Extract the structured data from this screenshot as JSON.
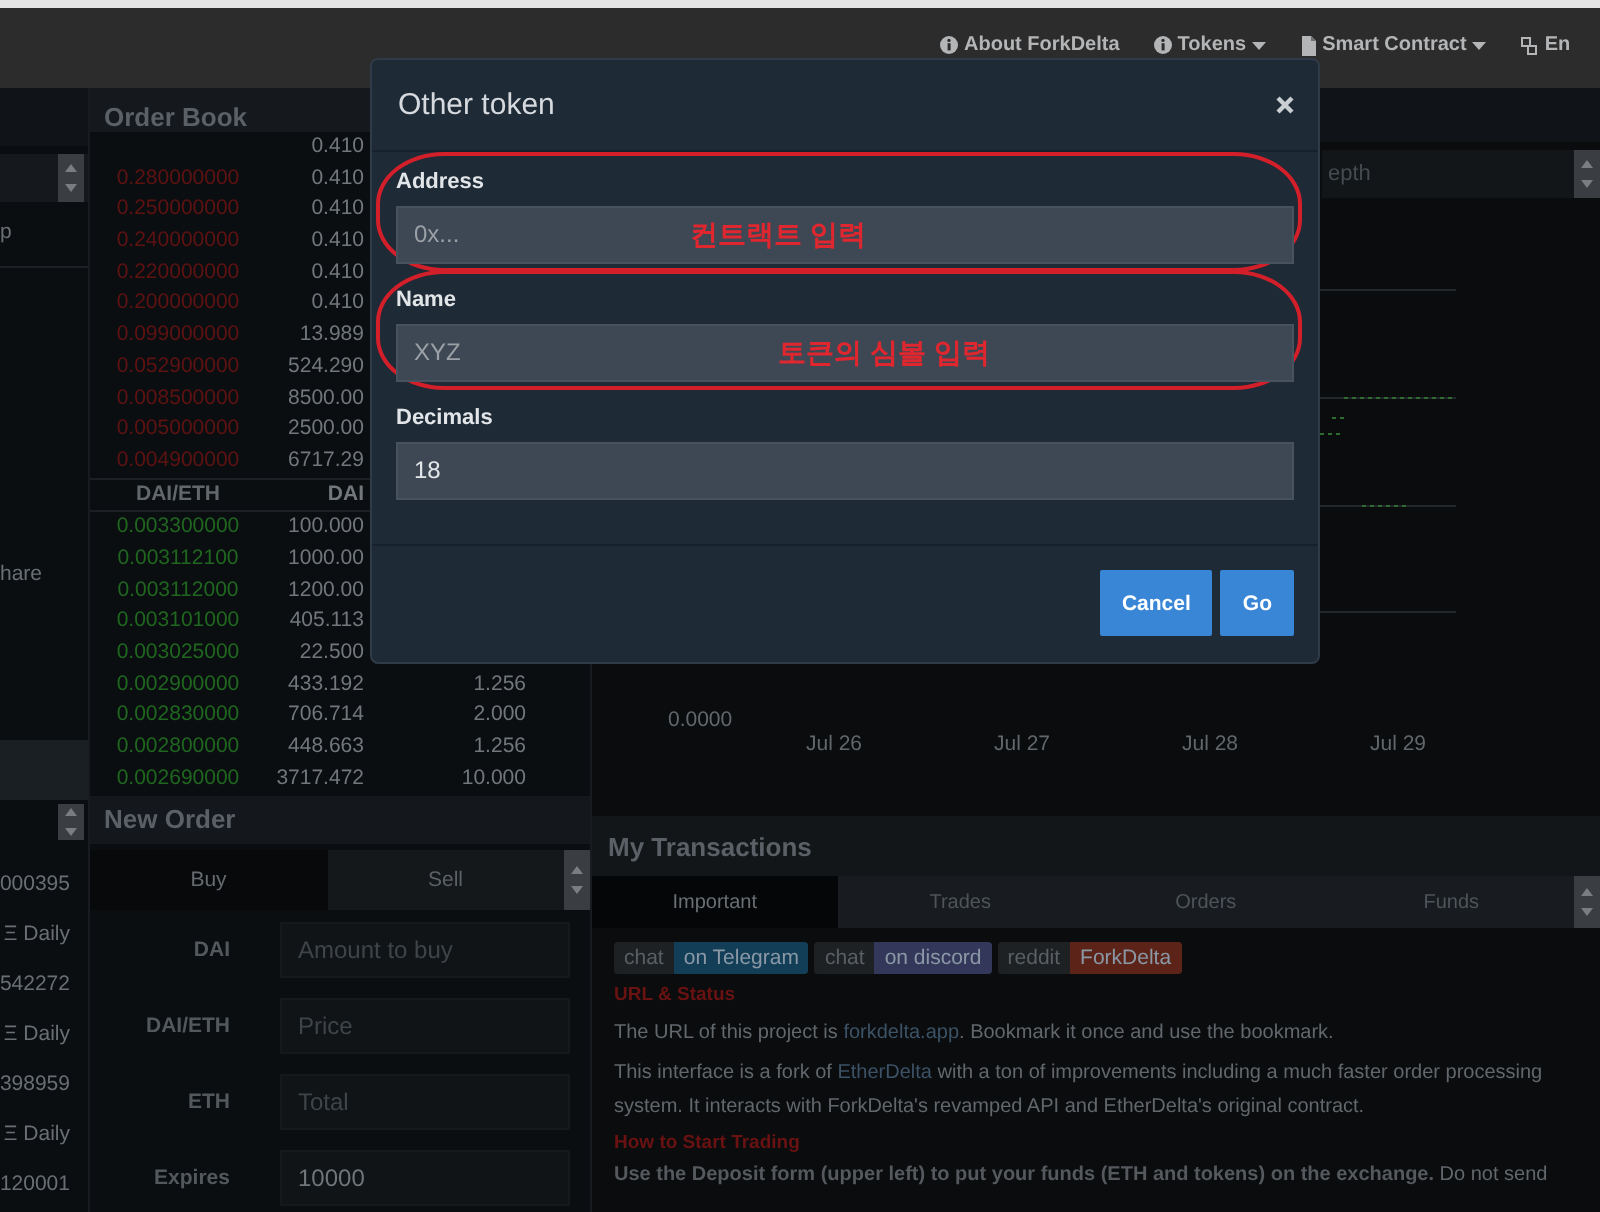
{
  "nav": {
    "items": [
      {
        "label": "About ForkDelta",
        "dropdown": false
      },
      {
        "label": "Tokens",
        "dropdown": true
      },
      {
        "label": "Smart Contract",
        "dropdown": true
      },
      {
        "label": "En",
        "dropdown": false
      }
    ]
  },
  "left_panel": {
    "top_texts": [
      "p",
      "hare"
    ],
    "rows": [
      {
        "value": "000395",
        "period": "Ξ Daily"
      },
      {
        "value": "542272",
        "period": "Ξ Daily"
      },
      {
        "value": "398959",
        "period": "Ξ Daily"
      },
      {
        "value": "120001"
      }
    ]
  },
  "order_book": {
    "title": "Order Book",
    "sell_rows": [
      {
        "amount": "0.410"
      },
      {
        "price": "0.280000000",
        "amount": "0.410"
      },
      {
        "price": "0.250000000",
        "amount": "0.410"
      },
      {
        "price": "0.240000000",
        "amount": "0.410"
      },
      {
        "price": "0.220000000",
        "amount": "0.410"
      },
      {
        "price": "0.200000000",
        "amount": "0.410"
      },
      {
        "price": "0.099000000",
        "amount": "13.989"
      },
      {
        "price": "0.052900000",
        "amount": "524.290"
      },
      {
        "price": "0.008500000",
        "amount": "8500.00"
      },
      {
        "price": "0.005000000",
        "amount": "2500.00"
      },
      {
        "price": "0.004900000",
        "amount": "6717.29"
      }
    ],
    "columns": [
      "DAI/ETH",
      "DAI"
    ],
    "buy_rows": [
      {
        "price": "0.003300000",
        "amount": "100.000"
      },
      {
        "price": "0.003112100",
        "amount": "1000.00"
      },
      {
        "price": "0.003112000",
        "amount": "1200.00"
      },
      {
        "price": "0.003101000",
        "amount": "405.113"
      },
      {
        "price": "0.003025000",
        "amount": "22.500"
      },
      {
        "price": "0.002900000",
        "amount": "433.192",
        "total": "1.256"
      },
      {
        "price": "0.002830000",
        "amount": "706.714",
        "total": "2.000"
      },
      {
        "price": "0.002800000",
        "amount": "448.663",
        "total": "1.256"
      },
      {
        "price": "0.002690000",
        "amount": "3717.472",
        "total": "10.000"
      }
    ]
  },
  "new_order": {
    "title": "New Order",
    "tabs": [
      {
        "label": "Buy",
        "selected": true
      },
      {
        "label": "Sell",
        "selected": false
      }
    ],
    "fields": [
      {
        "label": "DAI",
        "placeholder": "Amount to buy"
      },
      {
        "label": "DAI/ETH",
        "placeholder": "Price"
      },
      {
        "label": "ETH",
        "placeholder": "Total"
      },
      {
        "label": "Expires",
        "value": "10000"
      }
    ]
  },
  "chart": {
    "select_value": "epth",
    "y_label": "0.0000",
    "x_labels": [
      "Jul 26",
      "Jul 27",
      "Jul 28",
      "Jul 29"
    ]
  },
  "transactions": {
    "title": "My Transactions",
    "tabs": [
      {
        "label": "Important",
        "selected": true
      },
      {
        "label": "Trades",
        "selected": false
      },
      {
        "label": "Orders",
        "selected": false
      },
      {
        "label": "Funds",
        "selected": false
      }
    ],
    "badges": [
      {
        "left": "chat",
        "right": "on Telegram",
        "color": "#123f57"
      },
      {
        "left": "chat",
        "right": "on discord",
        "color": "#33385a"
      },
      {
        "left": "reddit",
        "right": "ForkDelta",
        "color": "#5c2418"
      }
    ],
    "content": [
      {
        "kind": "heading",
        "text": "URL & Status"
      },
      {
        "kind": "paragraph",
        "parts": [
          {
            "text": "The URL of this project is "
          },
          {
            "link": "forkdelta.app"
          },
          {
            "text": ". Bookmark it once and use the bookmark."
          }
        ]
      },
      {
        "kind": "paragraph",
        "parts": [
          {
            "text": "This interface is a fork of "
          },
          {
            "link": "EtherDelta"
          },
          {
            "text": " with a ton of improvements including a much faster order processing system. It interacts with ForkDelta's revamped API and EtherDelta's original contract."
          }
        ]
      },
      {
        "kind": "heading",
        "text": "How to Start Trading"
      },
      {
        "kind": "rich",
        "text": "**Use the Deposit form (upper left) to put your funds (ETH and tokens) on the exchange.** Do not send"
      }
    ]
  },
  "modal": {
    "title": "Other token",
    "fields": [
      {
        "label": "Address",
        "placeholder": "0x...",
        "annotation": "컨트랙트 입력"
      },
      {
        "label": "Name",
        "placeholder": "XYZ",
        "annotation": "토큰의 심볼 입력"
      },
      {
        "label": "Decimals",
        "value": "18"
      }
    ],
    "buttons": [
      {
        "label": "Cancel"
      },
      {
        "label": "Go"
      }
    ]
  }
}
